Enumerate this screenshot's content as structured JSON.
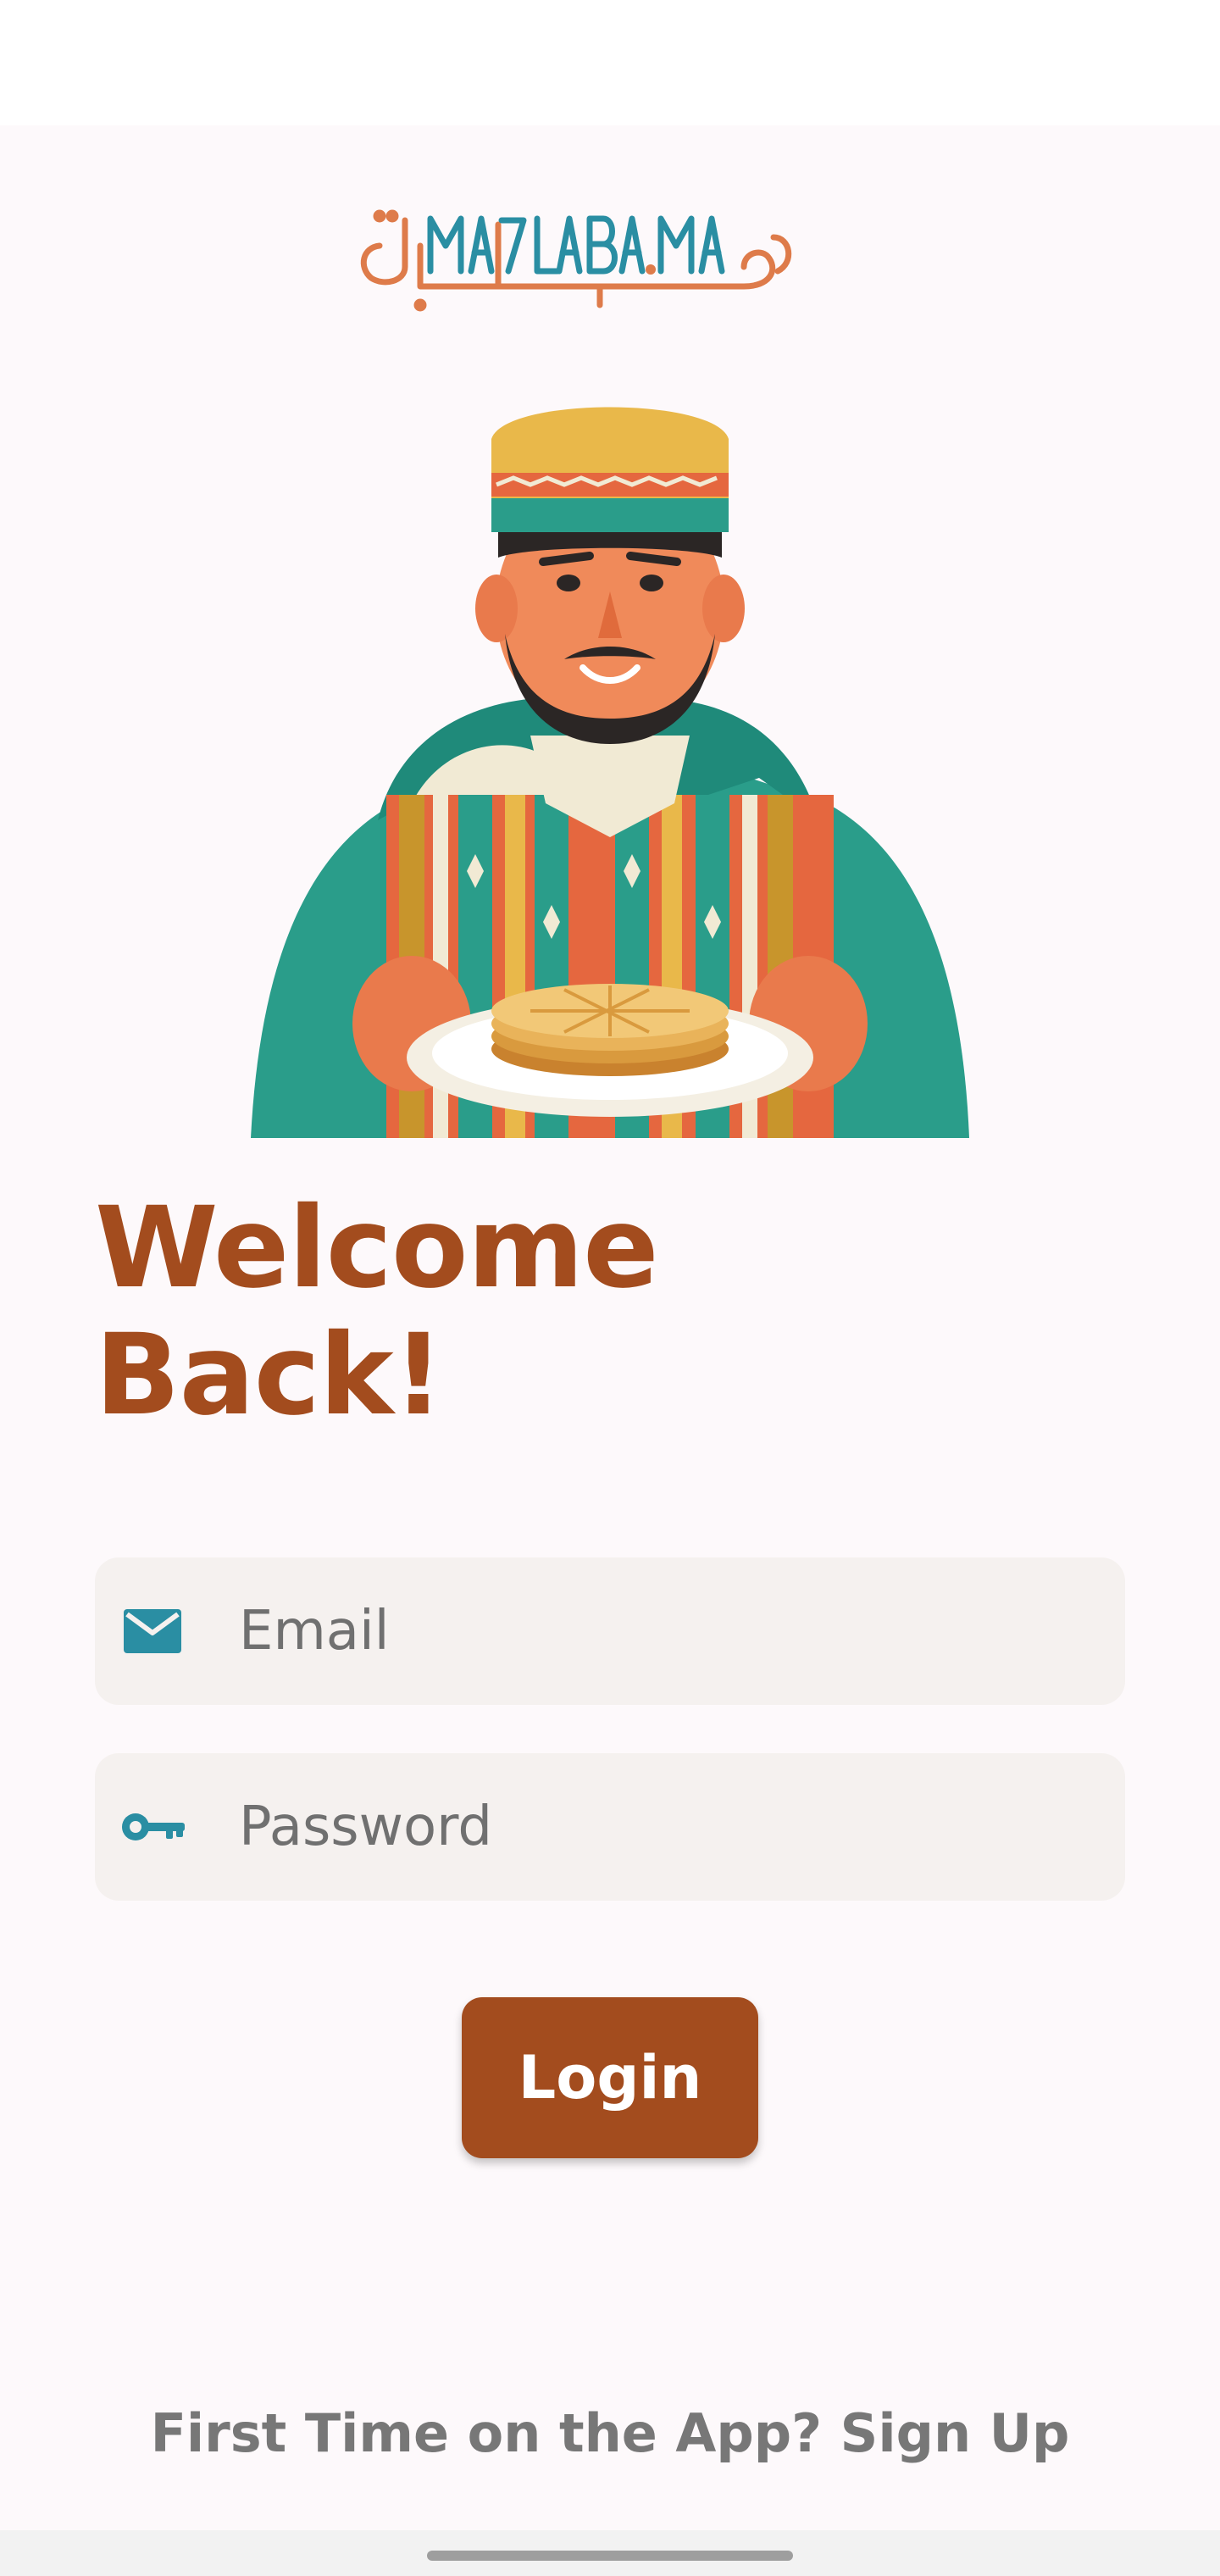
{
  "app": {
    "logo_text_latin": "MA7LABA.MA",
    "logo_text_arabic": "محلبة"
  },
  "hero": {
    "image": "illustration of smiling man in fez and striped djellaba holding plate of pancakes"
  },
  "welcome": {
    "line1": "Welcome",
    "line2": "Back!"
  },
  "form": {
    "email": {
      "placeholder": "Email",
      "value": "",
      "icon": "mail-icon"
    },
    "password": {
      "placeholder": "Password",
      "value": "",
      "icon": "key-icon"
    },
    "login_label": "Login"
  },
  "footer": {
    "signup_text": "First Time on the App? Sign Up"
  },
  "colors": {
    "brand_brown": "#a34c1e",
    "teal": "#2a8ea3",
    "field_bg": "#f5f1ef",
    "screen_bg": "#fdf9fb"
  }
}
